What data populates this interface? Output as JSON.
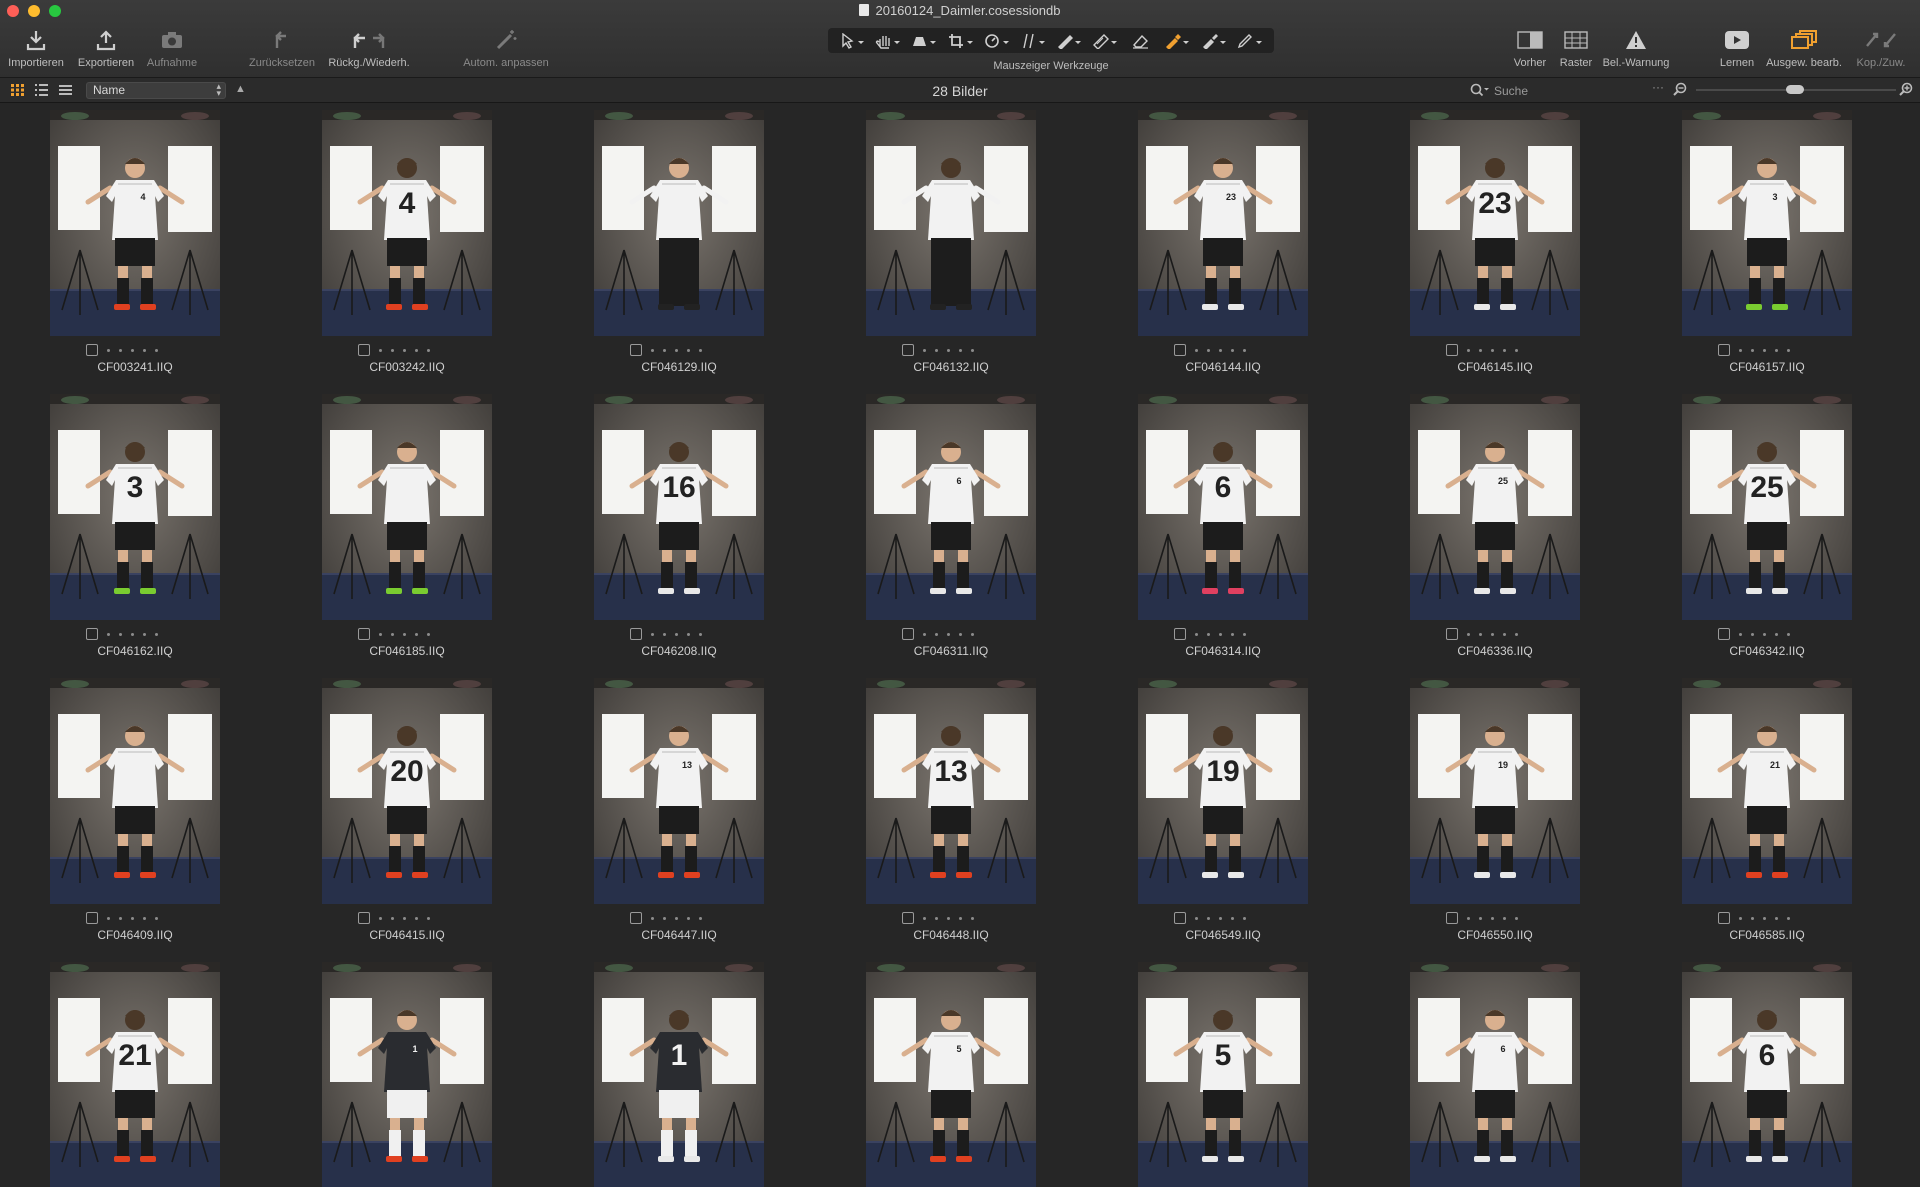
{
  "window": {
    "title": "20160124_Daimler.cosessiondb"
  },
  "toolbar": {
    "import": "Importieren",
    "export": "Exportieren",
    "capture": "Aufnahme",
    "reset": "Zurücksetzen",
    "undo_redo": "Rückg./Wiederh.",
    "auto_adjust": "Autom. anpassen",
    "cursor_tools": "Mauszeiger Werkzeuge",
    "before": "Vorher",
    "grid": "Raster",
    "exposure_warning": "Bel.-Warnung",
    "learn": "Lernen",
    "edit_selected": "Ausgew. bearb.",
    "copy_apply": "Kop./Zuw."
  },
  "browser": {
    "sort_field": "Name",
    "image_count": "28 Bilder",
    "search_placeholder": "Suche"
  },
  "colors": {
    "accent": "#f0a030",
    "background": "#262626"
  },
  "images": [
    {
      "file": "CF003241.IIQ",
      "number": "4",
      "view": "front",
      "kit": "white",
      "boots": "#e04020"
    },
    {
      "file": "CF003242.IIQ",
      "number": "4",
      "view": "back",
      "kit": "white",
      "boots": "#e04020"
    },
    {
      "file": "CF046129.IIQ",
      "number": "",
      "view": "front",
      "kit": "shirt",
      "boots": "#222222"
    },
    {
      "file": "CF046132.IIQ",
      "number": "",
      "view": "back",
      "kit": "shirt",
      "boots": "#222222"
    },
    {
      "file": "CF046144.IIQ",
      "number": "23",
      "view": "front",
      "kit": "white",
      "boots": "#e8e8e8"
    },
    {
      "file": "CF046145.IIQ",
      "number": "23",
      "view": "back",
      "kit": "white",
      "boots": "#e8e8e8"
    },
    {
      "file": "CF046157.IIQ",
      "number": "3",
      "view": "front",
      "kit": "white",
      "boots": "#7acc30"
    },
    {
      "file": "CF046162.IIQ",
      "number": "3",
      "view": "back",
      "kit": "white",
      "boots": "#7acc30"
    },
    {
      "file": "CF046185.IIQ",
      "number": "",
      "view": "front",
      "kit": "white",
      "boots": "#7acc30"
    },
    {
      "file": "CF046208.IIQ",
      "number": "16",
      "view": "back",
      "kit": "white",
      "boots": "#e8e8e8"
    },
    {
      "file": "CF046311.IIQ",
      "number": "6",
      "view": "front",
      "kit": "white",
      "boots": "#e8e8e8"
    },
    {
      "file": "CF046314.IIQ",
      "number": "6",
      "view": "back",
      "kit": "white",
      "boots": "#e04060"
    },
    {
      "file": "CF046336.IIQ",
      "number": "25",
      "view": "front",
      "kit": "white",
      "boots": "#e8e8e8"
    },
    {
      "file": "CF046342.IIQ",
      "number": "25",
      "view": "back",
      "kit": "white",
      "boots": "#e8e8e8"
    },
    {
      "file": "CF046409.IIQ",
      "number": "",
      "view": "front",
      "kit": "white",
      "boots": "#e04020"
    },
    {
      "file": "CF046415.IIQ",
      "number": "20",
      "view": "back",
      "kit": "white",
      "boots": "#e04020"
    },
    {
      "file": "CF046447.IIQ",
      "number": "13",
      "view": "front",
      "kit": "white",
      "boots": "#e04020"
    },
    {
      "file": "CF046448.IIQ",
      "number": "13",
      "view": "back",
      "kit": "white",
      "boots": "#e04020"
    },
    {
      "file": "CF046549.IIQ",
      "number": "19",
      "view": "back",
      "kit": "white",
      "boots": "#e8e8e8"
    },
    {
      "file": "CF046550.IIQ",
      "number": "19",
      "view": "front",
      "kit": "white",
      "boots": "#e8e8e8"
    },
    {
      "file": "CF046585.IIQ",
      "number": "21",
      "view": "front",
      "kit": "white",
      "boots": "#e04020"
    },
    {
      "file": "",
      "number": "21",
      "view": "back",
      "kit": "white",
      "boots": "#e04020"
    },
    {
      "file": "",
      "number": "1",
      "view": "front",
      "kit": "keeper",
      "boots": "#e04020"
    },
    {
      "file": "",
      "number": "1",
      "view": "back",
      "kit": "keeper",
      "boots": "#e8e8e8"
    },
    {
      "file": "",
      "number": "5",
      "view": "front",
      "kit": "white",
      "boots": "#e04020"
    },
    {
      "file": "",
      "number": "5",
      "view": "back",
      "kit": "white",
      "boots": "#e8e8e8"
    },
    {
      "file": "",
      "number": "6",
      "view": "front",
      "kit": "white",
      "boots": "#e8e8e8"
    },
    {
      "file": "",
      "number": "6",
      "view": "back",
      "kit": "white",
      "boots": "#e8e8e8"
    }
  ]
}
